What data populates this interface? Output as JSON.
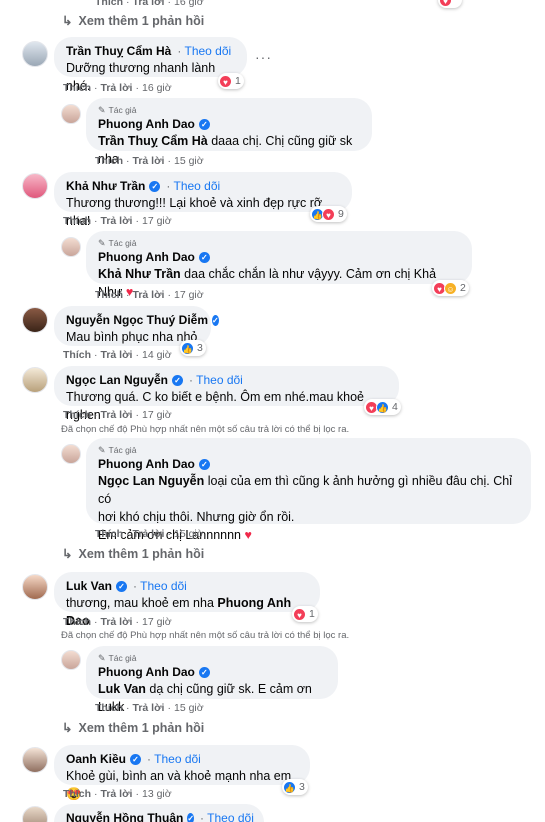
{
  "top": {
    "actions": {
      "like": "Thích",
      "reply": "Trả lời",
      "time": "16 giờ"
    },
    "more": "Xem thêm 1 phản hồi"
  },
  "labels": {
    "like": "Thích",
    "reply": "Trả lời",
    "follow": "Theo dõi",
    "author": "Tác giả",
    "more_replies": "Xem thêm 1 phản hồi",
    "filter_note": "Đã chọn chế độ Phù hợp nhất nên một số câu trả lời có thể bị lọc ra."
  },
  "comments": [
    {
      "name": "Trần Thuỵ Cẩm Hà",
      "follow": true,
      "text": "Dưỡng thương nhanh lành nhé.",
      "time": "16 giờ",
      "reactions": "1",
      "reply": {
        "name": "Phuong Anh Dao",
        "mention": "Trần Thuỵ Cẩm Hà",
        "text": " daaa chị. Chị cũng giữ sk nha",
        "time": "15 giờ"
      }
    },
    {
      "name": "Khả Như Trần",
      "follow": true,
      "text": "Thương thương!!! Lại khoẻ và xinh đẹp rực rỡ nha!",
      "time": "17 giờ",
      "reactions": "9",
      "reply": {
        "name": "Phuong Anh Dao",
        "mention": "Khả Như Trần",
        "text": " daa chắc chắn là như vậyyy. Cảm ơn chị Khả Như ",
        "time": "17 giờ",
        "reactions": "2"
      }
    },
    {
      "name": "Nguyễn Ngọc Thuý Diễm",
      "text": "Mau bình phục nha nhỏ",
      "time": "14 giờ",
      "reactions": "3"
    },
    {
      "name": "Ngọc Lan Nguyễn",
      "follow": true,
      "text": "Thương quá. C ko biết e bệnh. Ôm em nhé.mau khoẻ nghen",
      "time": "17 giờ",
      "reactions": "4",
      "reply": {
        "name": "Phuong Anh Dao",
        "mention": "Ngọc Lan Nguyễn",
        "line1": " loại của em thì cũng k ảnh hưởng gì nhiều đâu chị. Chỉ có",
        "line2": "hơi khó chịu thôi. Nhưng giờ ổn rồi.",
        "line3": "Em cảm ơn chị Lannnnnn ",
        "time": "15 giờ"
      }
    },
    {
      "name": "Luk Van",
      "follow": true,
      "text": "thương, mau khoẻ em nha ",
      "mention": "Phuong Anh Dao",
      "time": "17 giờ",
      "reactions": "1",
      "reply": {
        "name": "Phuong Anh Dao",
        "mention": "Luk Van",
        "text": " dạ chị cũng giữ sk. E cảm ơn Lukk",
        "time": "15 giờ"
      }
    },
    {
      "name": "Oanh Kiều",
      "follow": true,
      "text": "Khoẻ gùi, bình an và khoẻ mạnh nha em",
      "time": "13 giờ",
      "reactions": "3"
    },
    {
      "name": "Nguyễn Hồng Thuận",
      "follow": true
    }
  ],
  "colors": {
    "link": "#1877f2",
    "muted": "#65676b",
    "bubble": "#f0f2f5",
    "heart": "#f33e58"
  }
}
